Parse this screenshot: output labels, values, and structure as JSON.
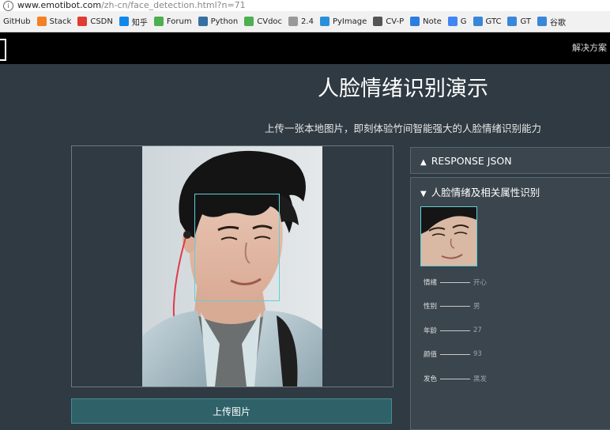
{
  "browser": {
    "url_main": "www.emotibot.com",
    "url_path": "/zh-cn/face_detection.html?n=71"
  },
  "bookmarks": [
    {
      "label": "GitHub",
      "icon": "github-icon",
      "color": ""
    },
    {
      "label": "Stack",
      "icon": "stack-icon",
      "color": "#f48024"
    },
    {
      "label": "CSDN",
      "icon": "csdn-icon",
      "color": "#e03c31"
    },
    {
      "label": "知乎",
      "icon": "zhihu-icon",
      "color": "#0f88eb"
    },
    {
      "label": "Forum",
      "icon": "forum-icon",
      "color": "#4caf50"
    },
    {
      "label": "Python",
      "icon": "python-icon",
      "color": "#3670a0"
    },
    {
      "label": "CVdoc",
      "icon": "cvdoc-icon",
      "color": "#4caf50"
    },
    {
      "label": "2.4",
      "icon": "page-icon",
      "color": "#999999"
    },
    {
      "label": "PyImage",
      "icon": "pyimage-icon",
      "color": "#2b8fd8"
    },
    {
      "label": "CV-P",
      "icon": "cvp-icon",
      "color": "#555555"
    },
    {
      "label": "Note",
      "icon": "note-icon",
      "color": "#2b7de0"
    },
    {
      "label": "G",
      "icon": "google-icon",
      "color": "#4285f4"
    },
    {
      "label": "GTC",
      "icon": "gtc-icon",
      "color": "#3a86d8"
    },
    {
      "label": "GT",
      "icon": "gt-icon",
      "color": "#3a86d8"
    },
    {
      "label": "谷歌",
      "icon": "translate-icon",
      "color": "#3a86d8"
    }
  ],
  "nav": {
    "right_label": "解决方案"
  },
  "page": {
    "title": "人脸情绪识别演示",
    "subtitle": "上传一张本地图片，即刻体验竹间智能强大的人脸情绪识别能力",
    "upload_label": "上传图片"
  },
  "panels": {
    "json_label": "RESPONSE JSON",
    "face_label": "人脸情绪及相关属性识别",
    "attributes": [
      {
        "key": "情绪",
        "value": "开心"
      },
      {
        "key": "性别",
        "value": "男"
      },
      {
        "key": "年龄",
        "value": "27"
      },
      {
        "key": "颜值",
        "value": "93"
      },
      {
        "key": "发色",
        "value": "黑发"
      }
    ]
  },
  "colors": {
    "background": "#2f3a42",
    "accent": "#2f6169",
    "facebox": "#5fd0d8"
  }
}
